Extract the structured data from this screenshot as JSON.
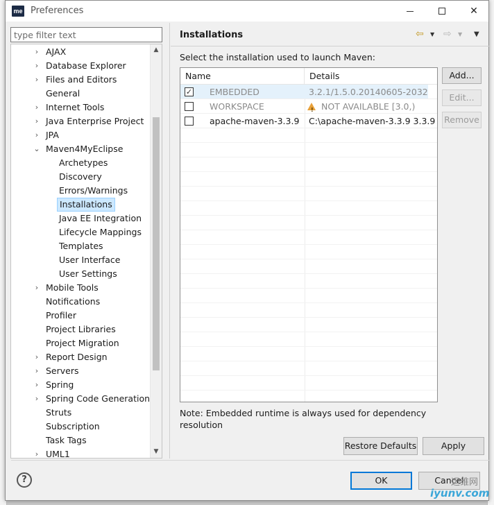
{
  "window": {
    "title": "Preferences",
    "logo": "me"
  },
  "filter": {
    "placeholder": "type filter text"
  },
  "tree": {
    "items": [
      {
        "label": "AJAX",
        "arrow": "›"
      },
      {
        "label": "Database Explorer",
        "arrow": "›"
      },
      {
        "label": "Files and Editors",
        "arrow": "›"
      },
      {
        "label": "General",
        "arrow": ""
      },
      {
        "label": "Internet Tools",
        "arrow": "›"
      },
      {
        "label": "Java Enterprise Project",
        "arrow": "›"
      },
      {
        "label": "JPA",
        "arrow": "›"
      },
      {
        "label": "Maven4MyEclipse",
        "arrow": "⌄"
      },
      {
        "label": "Archetypes",
        "arrow": ""
      },
      {
        "label": "Discovery",
        "arrow": ""
      },
      {
        "label": "Errors/Warnings",
        "arrow": ""
      },
      {
        "label": "Installations",
        "arrow": ""
      },
      {
        "label": "Java EE Integration",
        "arrow": ""
      },
      {
        "label": "Lifecycle Mappings",
        "arrow": ""
      },
      {
        "label": "Templates",
        "arrow": ""
      },
      {
        "label": "User Interface",
        "arrow": ""
      },
      {
        "label": "User Settings",
        "arrow": ""
      },
      {
        "label": "Mobile Tools",
        "arrow": "›"
      },
      {
        "label": "Notifications",
        "arrow": ""
      },
      {
        "label": "Profiler",
        "arrow": ""
      },
      {
        "label": "Project Libraries",
        "arrow": ""
      },
      {
        "label": "Project Migration",
        "arrow": ""
      },
      {
        "label": "Report Design",
        "arrow": "›"
      },
      {
        "label": "Servers",
        "arrow": "›"
      },
      {
        "label": "Spring",
        "arrow": "›"
      },
      {
        "label": "Spring Code Generation",
        "arrow": "›"
      },
      {
        "label": "Struts",
        "arrow": ""
      },
      {
        "label": "Subscription",
        "arrow": ""
      },
      {
        "label": "Task Tags",
        "arrow": ""
      },
      {
        "label": "UML1",
        "arrow": "›"
      }
    ]
  },
  "page": {
    "title": "Installations",
    "description": "Select the installation used to launch Maven:",
    "columns": {
      "name": "Name",
      "details": "Details"
    },
    "rows": [
      {
        "checked": "✓",
        "name": "EMBEDDED",
        "details": "3.2.1/1.5.0.20140605-2032"
      },
      {
        "checked": "",
        "name": "WORKSPACE",
        "details": "NOT AVAILABLE [3.0,)"
      },
      {
        "checked": "",
        "name": "apache-maven-3.3.9",
        "details": "C:\\apache-maven-3.3.9 3.3.9"
      }
    ],
    "buttons": {
      "add": "Add...",
      "edit": "Edit...",
      "remove": "Remove"
    },
    "note": "Note: Embedded runtime is always used for dependency resolution",
    "restore_defaults": "Restore Defaults",
    "apply": "Apply"
  },
  "footer": {
    "ok": "OK",
    "cancel": "Cancel",
    "help": "?"
  },
  "watermark": {
    "top": "运维网",
    "bottom": "iyunv.com"
  }
}
